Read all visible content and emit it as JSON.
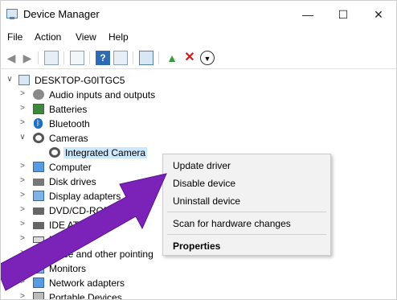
{
  "window": {
    "title": "Device Manager",
    "minimize_icon": "—",
    "maximize_icon": "☐",
    "close_icon": "✕"
  },
  "menubar": {
    "items": [
      "File",
      "Action",
      "View",
      "Help"
    ]
  },
  "toolbar": {
    "icons": [
      "back-arrow-icon",
      "forward-arrow-icon",
      "show-hide-icon",
      "properties-icon",
      "help-icon",
      "view-icon",
      "monitor-scan-icon",
      "add-driver-icon",
      "uninstall-x-icon",
      "download-icon"
    ],
    "colors": {
      "uninstall": "#d21a1a",
      "help": "#2d6bb5",
      "add": "#3a9a3a"
    }
  },
  "tree": {
    "root": "DESKTOP-G0ITGC5",
    "nodes": [
      {
        "label": "Audio inputs and outputs",
        "expander": ">",
        "icon": "speaker-icon"
      },
      {
        "label": "Batteries",
        "expander": ">",
        "icon": "battery-icon"
      },
      {
        "label": "Bluetooth",
        "expander": ">",
        "icon": "bluetooth-icon"
      },
      {
        "label": "Cameras",
        "expander": "v",
        "icon": "camera-icon"
      },
      {
        "label": "Integrated Camera",
        "expander": "",
        "icon": "camera-icon",
        "selected": true
      },
      {
        "label": "Computer",
        "expander": ">",
        "icon": "computer-icon"
      },
      {
        "label": "Disk drives",
        "expander": ">",
        "icon": "disk-icon"
      },
      {
        "label": "Display adapters",
        "expander": ">",
        "icon": "display-icon"
      },
      {
        "label": "DVD/CD-ROM",
        "expander": ">",
        "icon": "dvd-icon"
      },
      {
        "label": "IDE ATA/A",
        "expander": ">",
        "icon": "ide-icon"
      },
      {
        "label": "Ke",
        "expander": ">",
        "icon": "keyboard-icon"
      },
      {
        "label": "ice and other pointing",
        "expander": ">",
        "icon": "mouse-icon"
      },
      {
        "label": "Monitors",
        "expander": ">",
        "icon": "monitor-icon"
      },
      {
        "label": "Network adapters",
        "expander": ">",
        "icon": "network-icon"
      },
      {
        "label": "Portable Devices",
        "expander": ">",
        "icon": "portable-icon"
      }
    ]
  },
  "context_menu": {
    "items": [
      "Update driver",
      "Disable device",
      "Uninstall device",
      "Scan for hardware changes",
      "Properties"
    ]
  },
  "annotation": {
    "color": "#7b23b8",
    "icon": "pointer-arrow"
  }
}
